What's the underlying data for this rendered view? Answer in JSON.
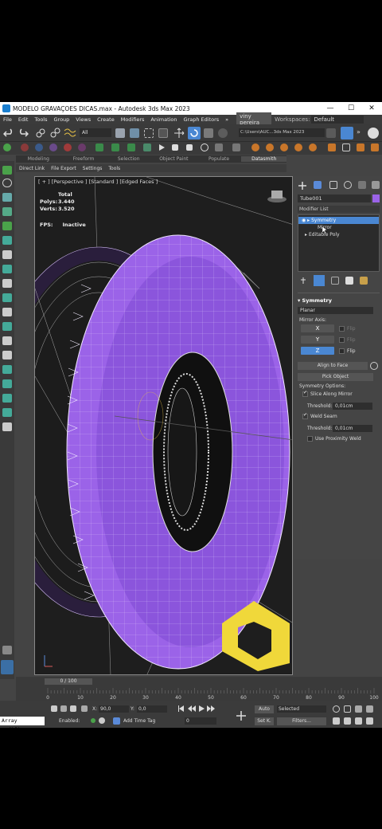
{
  "window": {
    "title": "MODELO GRAVAÇOES DICAS.max - Autodesk 3ds Max 2023",
    "minimize": "—",
    "maximize": "☐",
    "close": "✕"
  },
  "menu": {
    "items": [
      "File",
      "Edit",
      "Tools",
      "Group",
      "Views",
      "Create",
      "Modifiers",
      "Animation",
      "Graph Editors",
      "»"
    ],
    "user": "viny pereira",
    "workspace_label": "Workspaces:",
    "workspace_value": "Default"
  },
  "toolbar": {
    "selection_filter": "All",
    "path_value": "C:\\Users\\AUC...3ds Max 2023"
  },
  "ribbon": {
    "tabs": [
      "Modeling",
      "Freeform",
      "Selection",
      "Object Paint",
      "Populate",
      "Datasmith"
    ],
    "active": "Datasmith"
  },
  "submenu": {
    "items": [
      "Direct Link",
      "File Export",
      "Settings",
      "Tools"
    ]
  },
  "viewport": {
    "label": "[ + ] [Perspective ] [Standard ] [Edged Faces ]",
    "stats": {
      "total_label": "Total",
      "polys_label": "Polys:",
      "polys": "3.440",
      "verts_label": "Verts:",
      "verts": "3.520"
    },
    "fps_label": "FPS:",
    "fps_value": "Inactive",
    "tire_color": "#9b63e8"
  },
  "panel": {
    "object_name": "Tube001",
    "object_color": "#9b63e8",
    "modifier_list": "Modifier List",
    "stack": [
      {
        "label": "Symmetry",
        "selected": true,
        "prefix": "▸"
      },
      {
        "label": "Mirror",
        "selected": false,
        "prefix": ""
      },
      {
        "label": "Editable Poly",
        "selected": false,
        "prefix": "▸"
      }
    ],
    "rollout_title": "Symmetry",
    "plane_value": "Planar",
    "mirror_axis_label": "Mirror Axis:",
    "axes": [
      "X",
      "Y",
      "Z"
    ],
    "flip_label": "Flip",
    "align_button": "Align to Face",
    "pick_button": "Pick Object",
    "options_label": "Symmetry Options:",
    "slice_label": "Slice Along Mirror",
    "threshold_label": "Threshold:",
    "threshold1": "0,01cm",
    "weld_label": "Weld Seam",
    "threshold2": "0,01cm",
    "proximity_label": "Use Proximity Weld"
  },
  "timeline": {
    "slider_value": "0 / 100",
    "ticks": [
      "0",
      "10",
      "20",
      "30",
      "40",
      "50",
      "60",
      "70",
      "80",
      "90",
      "100"
    ]
  },
  "status": {
    "prompt": "Array modifier",
    "x_label": "X:",
    "x_value": "90,0",
    "y_label": "Y:",
    "y_value": "0,0",
    "enabled_label": "Enabled:",
    "time_tag": "Add Time Tag",
    "frame_value": "0",
    "auto_label": "Auto",
    "selected_value": "Selected",
    "setk_label": "Set K.",
    "filters_label": "Filters..."
  }
}
